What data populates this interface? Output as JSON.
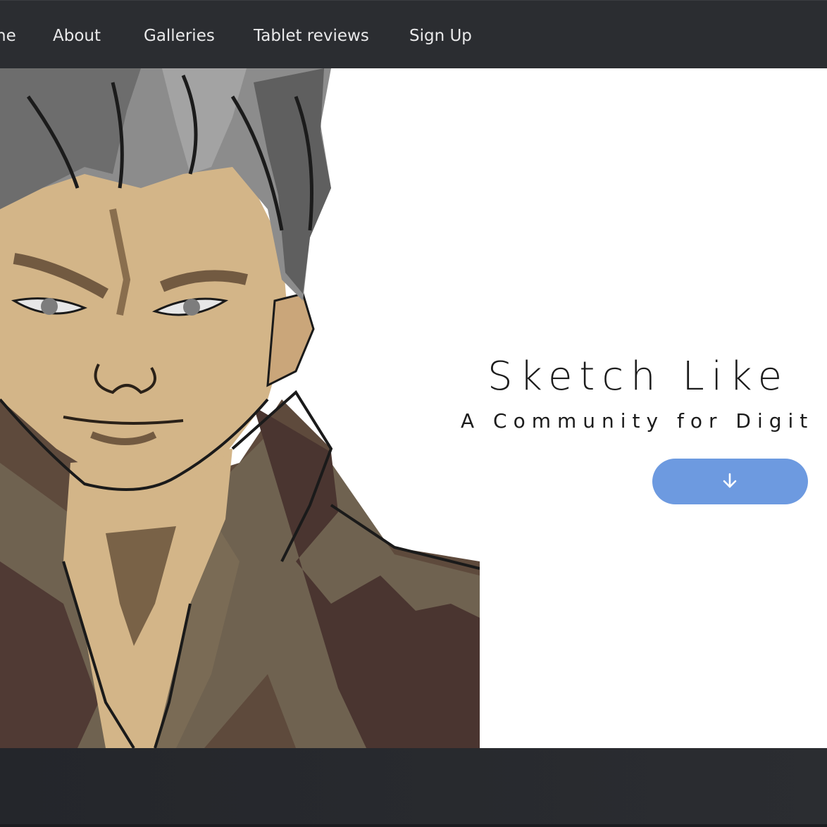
{
  "nav": {
    "items": [
      {
        "label": "ne"
      },
      {
        "label": "About"
      },
      {
        "label": "Galleries"
      },
      {
        "label": "Tablet reviews"
      },
      {
        "label": "Sign Up"
      }
    ]
  },
  "hero": {
    "title": "Sketch Like",
    "subtitle": "A Community for Digit",
    "button_icon": "arrow-down-icon",
    "accent_color": "#6d9ae0"
  },
  "colors": {
    "nav_bg": "#2b2d31",
    "footer_bg": "#26282d"
  }
}
